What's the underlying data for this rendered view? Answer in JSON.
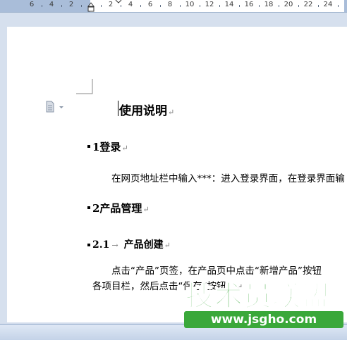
{
  "ruler": {
    "numbers": [
      "6",
      "4",
      "2",
      "2",
      "4",
      "6",
      "8",
      "10",
      "12",
      "14",
      "16",
      "18",
      "20",
      "22",
      "24"
    ]
  },
  "document": {
    "title": "使用说明",
    "sections": [
      {
        "heading": "1登录",
        "body": "在网页地址栏中输入***：进入登录界面，在登录界面输"
      },
      {
        "heading": "2产品管理"
      },
      {
        "heading": "2.1",
        "subheading": "产品创建",
        "body_line1": "点击“产品”页签，在产品页中点击“新增产品”按钮",
        "body_line2": "各项目栏，然后点击“保存”按钮。"
      }
    ],
    "paragraph_mark": "↵",
    "tab_mark": "→"
  },
  "watermark": {
    "title": "技术员联盟",
    "url": "www.jsgho.com"
  },
  "colors": {
    "ruler_margin": "#a9bdd9",
    "workspace": "#d6e0ee",
    "watermark_green": "#3aa83a"
  }
}
